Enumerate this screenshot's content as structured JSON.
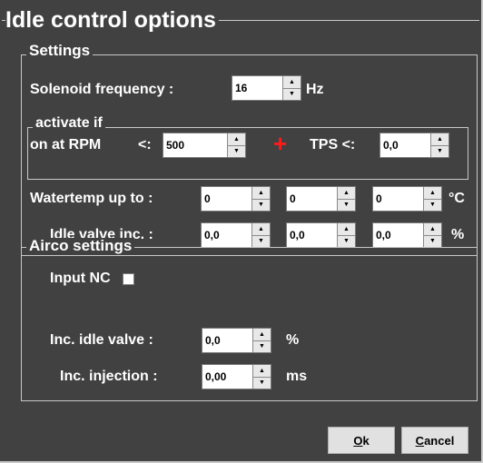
{
  "dialog": {
    "title": "Idle control options",
    "settings": {
      "legend": "Settings",
      "solenoid_label": "Solenoid frequency :",
      "solenoid_value": "16",
      "solenoid_unit": "Hz",
      "activate": {
        "legend": "activate if",
        "rpm_label": "on at RPM",
        "rpm_op": "<:",
        "rpm_value": "500",
        "tps_label": "TPS <:",
        "tps_value": "0,0"
      },
      "watertemp_label": "Watertemp up to :",
      "watertemp_values": [
        "0",
        "0",
        "0"
      ],
      "watertemp_unit": "°C",
      "idle_valve_label": "Idle valve inc. :",
      "idle_valve_values": [
        "0,0",
        "0,0",
        "0,0"
      ],
      "idle_valve_unit": "%"
    },
    "airco": {
      "legend": "Airco settings",
      "input_nc_label": "Input NC",
      "input_nc_checked": false,
      "inc_idle_label": "Inc. idle valve :",
      "inc_idle_value": "0,0",
      "inc_idle_unit": "%",
      "inc_injection_label": "Inc. injection :",
      "inc_injection_value": "0,00",
      "inc_injection_unit": "ms"
    },
    "buttons": {
      "ok_mnemonic": "O",
      "ok_rest": "k",
      "cancel_mnemonic": "C",
      "cancel_rest": "ancel"
    }
  }
}
